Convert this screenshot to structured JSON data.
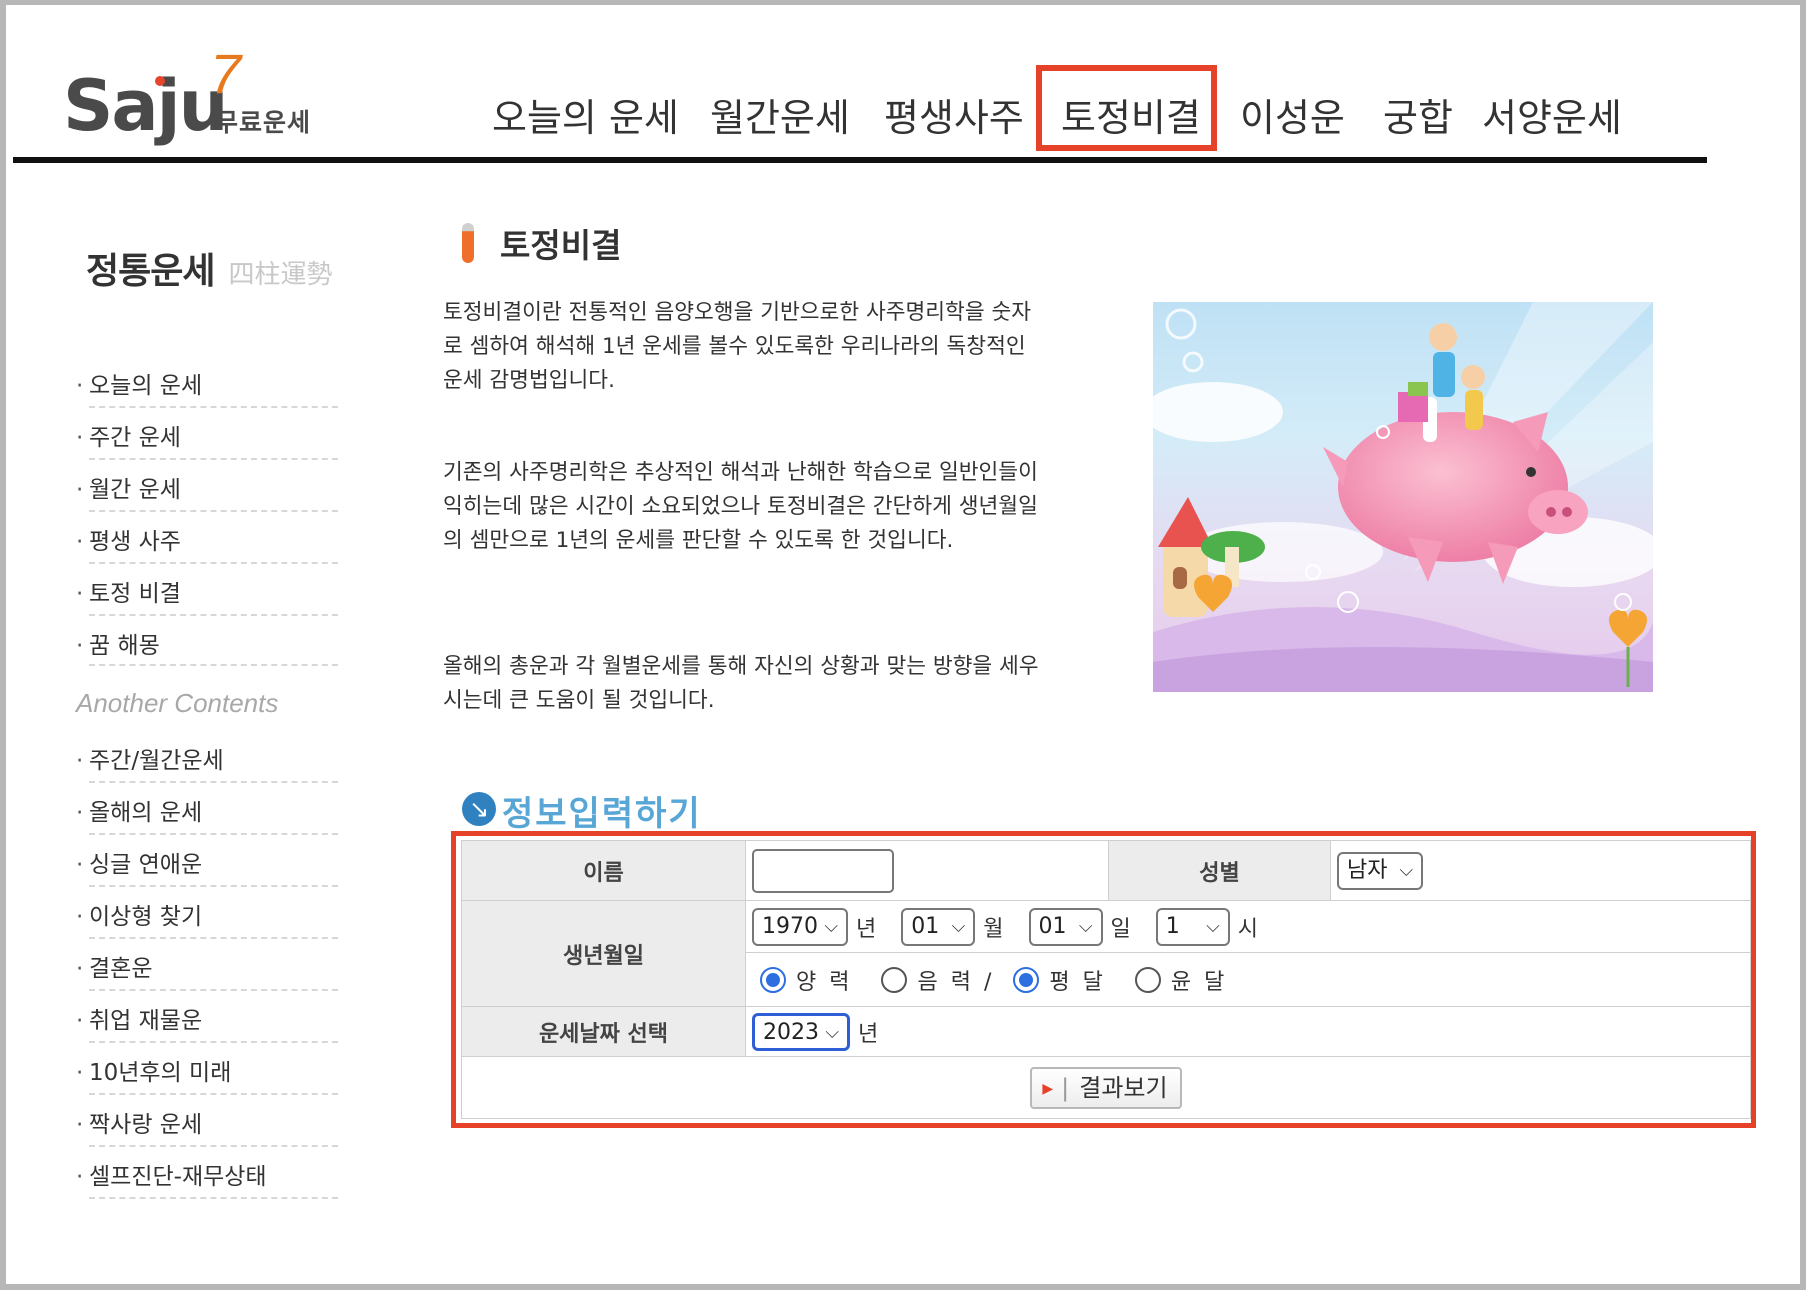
{
  "logo": {
    "brand": "Saju",
    "number": "7",
    "sub": "무료운세"
  },
  "nav": [
    {
      "label": "오늘의 운세"
    },
    {
      "label": "월간운세"
    },
    {
      "label": "평생사주"
    },
    {
      "label": "토정비결",
      "active": true
    },
    {
      "label": "이성운"
    },
    {
      "label": "궁합"
    },
    {
      "label": "서양운세"
    }
  ],
  "sidebar": {
    "title": "정통운세",
    "title_hanja": "四柱運勢",
    "items": [
      "오늘의 운세",
      "주간 운세",
      "월간 운세",
      "평생 사주",
      "토정 비결",
      "꿈 해몽"
    ],
    "another_title": "Another Contents",
    "another_items": [
      "주간/월간운세",
      "올해의 운세",
      "싱글 연애운",
      "이상형 찾기",
      "결혼운",
      "취업 재물운",
      "10년후의 미래",
      "짝사랑 운세",
      "셀프진단-재무상태"
    ]
  },
  "content": {
    "title": "토정비결",
    "paragraphs": [
      "토정비결이란 전통적인 음양오행을 기반으로한 사주명리학을 숫자로 셈하여 해석해 1년 운세를 볼수 있도록한 우리나라의 독창적인 운세 감명법입니다.",
      "기존의 사주명리학은 추상적인 해석과 난해한 학습으로 일반인들이 익히는데 많은 시간이 소요되었으나 토정비결은 간단하게 생년월일의 셈만으로 1년의 운세를 판단할 수 있도록 한 것입니다.",
      "올해의 총운과 각 월별운세를 통해 자신의 상황과 맞는 방향을 세우시는데 큰 도움이 될 것입니다."
    ]
  },
  "form": {
    "title": "정보입력하기",
    "name_label": "이름",
    "name_value": "",
    "gender_label": "성별",
    "gender_value": "남자",
    "birth_label": "생년월일",
    "year_value": "1970",
    "year_unit": "년",
    "month_value": "01",
    "month_unit": "월",
    "day_value": "01",
    "day_unit": "일",
    "hour_value": "1",
    "hour_unit": "시",
    "calendar": {
      "solar": "양 력",
      "lunar": "음 력 /",
      "normal": "평 달",
      "leap": "윤 달"
    },
    "fortune_label": "운세날짜 선택",
    "fortune_year": "2023",
    "fortune_unit": "년",
    "submit_label": "결과보기"
  },
  "colors": {
    "highlight": "#e6422a",
    "accent_orange": "#ef6f2a",
    "form_title_blue": "#57a6d6",
    "radio_blue": "#2d6fe0"
  }
}
